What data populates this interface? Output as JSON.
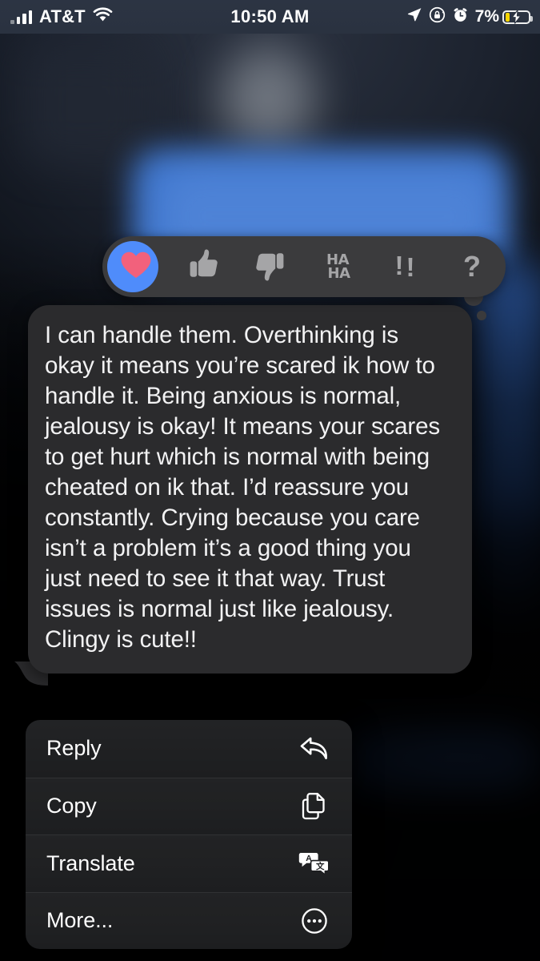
{
  "status_bar": {
    "carrier": "AT&T",
    "signal_icon": "cellular-signal-icon",
    "wifi_icon": "wifi-icon",
    "time": "10:50 AM",
    "location_icon": "location-arrow-icon",
    "rotation_lock_icon": "rotation-lock-icon",
    "alarm_icon": "alarm-clock-icon",
    "battery_percent": "7%",
    "battery_icon": "battery-charging-icon",
    "battery_fill_color": "#f5d400",
    "text_color": "#ffffff",
    "background_color": "#2c3443"
  },
  "tapback_bar": {
    "background_color": "#3b3b3d",
    "selected_index": 0,
    "selected_bg_color": "#4f8cfb",
    "heart_color": "#f2617c",
    "glyph_color": "#a5a5a7",
    "items": [
      {
        "name": "heart",
        "icon": "heart-icon",
        "label": "",
        "selected": true
      },
      {
        "name": "thumbs-up",
        "icon": "thumbs-up-icon",
        "label": "",
        "selected": false
      },
      {
        "name": "thumbs-down",
        "icon": "thumbs-down-icon",
        "label": "",
        "selected": false
      },
      {
        "name": "haha",
        "icon": "haha-icon",
        "label_line1": "HA",
        "label_line2": "HA",
        "selected": false
      },
      {
        "name": "exclamation",
        "icon": "double-exclamation-icon",
        "label": "!!",
        "selected": false
      },
      {
        "name": "question",
        "icon": "question-mark-icon",
        "label": "?",
        "selected": false
      }
    ]
  },
  "message": {
    "text": "I can handle them. Overthinking is okay it means you’re scared ik how to handle it. Being anxious is normal, jealousy is okay! It means your scares to get hurt which is normal with being cheated on ik that. I’d reassure you constantly. Crying because you care isn’t a problem it’s a good thing you just need to see it that way. Trust issues is normal just like jealousy. Clingy is cute!!",
    "bubble_color": "#2b2b2d",
    "text_color": "#f2f2f3",
    "side": "incoming"
  },
  "context_menu": {
    "background_color": "#1e1f21",
    "items": [
      {
        "label": "Reply",
        "icon": "reply-arrow-icon"
      },
      {
        "label": "Copy",
        "icon": "copy-documents-icon"
      },
      {
        "label": "Translate",
        "icon": "translate-bubbles-icon"
      },
      {
        "label": "More...",
        "icon": "ellipsis-circle-icon"
      }
    ]
  },
  "background": {
    "outgoing_bubble_color": "#3f77cf",
    "screen_background": "#05070a",
    "blurred": true
  }
}
